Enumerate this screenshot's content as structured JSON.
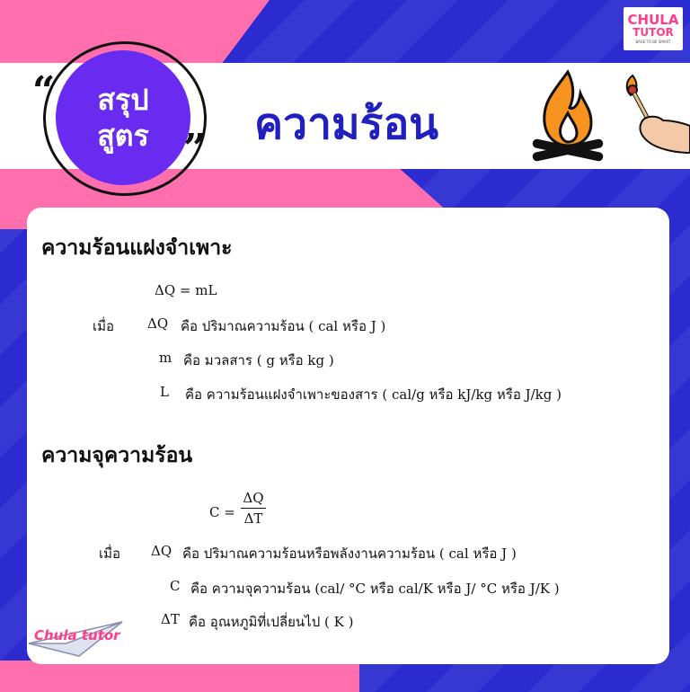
{
  "brand": {
    "logo_line1": "CHULA",
    "logo_line2": "TUTOR",
    "logo_tagline": "BASE TO BE SMART",
    "corner_logo": "Chula tutor"
  },
  "header": {
    "badge_line1": "สรุป",
    "badge_line2": "สูตร",
    "quote_open": "“",
    "quote_close": "”",
    "title": "ความร้อน"
  },
  "latent_heat": {
    "title": "ความร้อนแฝงจำเพาะ",
    "formula": "ΔQ = mL",
    "where": "เมื่อ",
    "rows": [
      {
        "sym": "ΔQ",
        "desc": "คือ ปริมาณความร้อน  ( cal หรือ J )"
      },
      {
        "sym": "m",
        "desc": "คือ มวลสาร  ( g  หรือ kg )"
      },
      {
        "sym": "L",
        "desc": "คือ ความร้อนแฝงจำเพาะของสาร ( cal/g  หรือ  kJ/kg   หรือ  J/kg )"
      }
    ]
  },
  "heat_capacity": {
    "title": "ความจุความร้อน",
    "formula_lhs": "C =",
    "formula_num": "ΔQ",
    "formula_den": "ΔT",
    "where": "เมื่อ",
    "rows": [
      {
        "sym": "ΔQ",
        "desc": "คือ ปริมาณความร้อนหรือพลังงานความร้อน  ( cal หรือ J )"
      },
      {
        "sym": "C",
        "desc": "คือ ความจุความร้อน  (cal/ °C หรือ cal/K  หรือ  J/ °C หรือ  J/K )"
      },
      {
        "sym": "ΔT",
        "desc": "คือ อุณหภูมิที่เปลี่ยนไป  ( K )"
      }
    ]
  },
  "colors": {
    "pink": "#ff6fae",
    "blue": "#2b2bd0",
    "purple": "#6a2bf0",
    "title_blue": "#2020c0",
    "fire_orange": "#f7931e"
  }
}
